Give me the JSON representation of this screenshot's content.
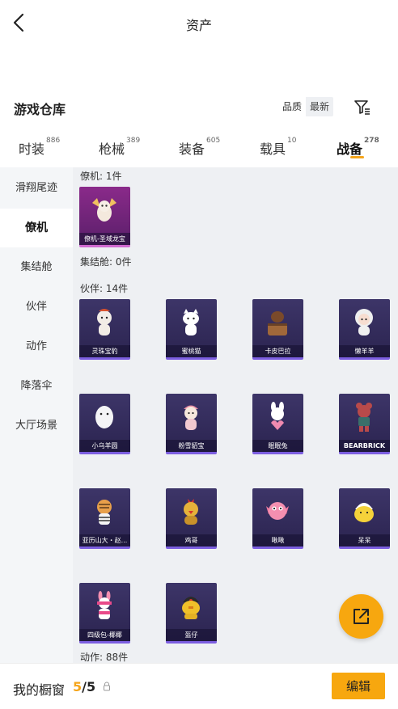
{
  "header": {
    "title": "资产"
  },
  "warehouse": {
    "title": "游戏仓库",
    "sort_quality": "品质",
    "sort_latest": "最新"
  },
  "tabs": [
    {
      "label": "时装",
      "count": "886"
    },
    {
      "label": "枪械",
      "count": "389"
    },
    {
      "label": "装备",
      "count": "605"
    },
    {
      "label": "载具",
      "count": "10"
    },
    {
      "label": "战备",
      "count": "278"
    }
  ],
  "sidebar": {
    "items": [
      {
        "label": "滑翔尾迹"
      },
      {
        "label": "僚机"
      },
      {
        "label": "集结舱"
      },
      {
        "label": "伙伴"
      },
      {
        "label": "动作"
      },
      {
        "label": "降落伞"
      },
      {
        "label": "大厅场景"
      }
    ]
  },
  "sections": {
    "wingman": "僚机: 1件",
    "capsule": "集结舱: 0件",
    "partner": "伙伴: 14件",
    "action": "动作: 88件"
  },
  "wingman_items": [
    {
      "name": "僚机-圣域龙宝"
    }
  ],
  "partner_items": [
    {
      "name": "灵珠宝豹"
    },
    {
      "name": "蜜桃猫"
    },
    {
      "name": "卡皮巴拉"
    },
    {
      "name": "懒羊羊"
    },
    {
      "name": "小乌羊圆"
    },
    {
      "name": "粉雪貂宝"
    },
    {
      "name": "眠眠兔"
    },
    {
      "name": "BEARBRICK"
    },
    {
      "name": "亚历山大・赵..."
    },
    {
      "name": "鸡哥"
    },
    {
      "name": "啾啾"
    },
    {
      "name": "呆呆"
    },
    {
      "name": "四级包-椰椰"
    },
    {
      "name": "盔仔"
    }
  ],
  "bottom_bar": {
    "label": "我的橱窗",
    "count_current": "5",
    "count_total": "/5",
    "edit_label": "编辑"
  },
  "colors": {
    "accent": "#f7a70f",
    "card_bg": "#2b2450",
    "card_border": "#7c5ee0"
  }
}
